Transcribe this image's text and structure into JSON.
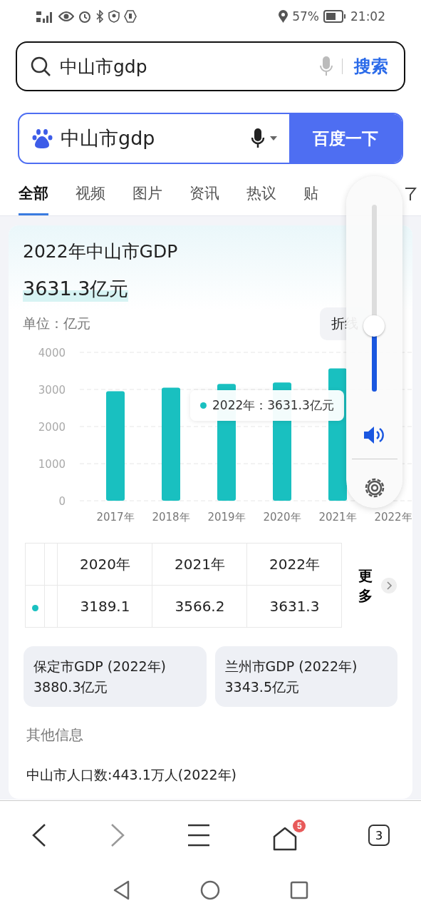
{
  "status_bar": {
    "battery": "57%",
    "time": "21:02"
  },
  "address_bar": {
    "value": "中山市gdp",
    "button": "搜索"
  },
  "search_box": {
    "value": "中山市gdp",
    "button": "百度一下"
  },
  "tabs": [
    {
      "label": "全部",
      "selected": true
    },
    {
      "label": "视频",
      "selected": false
    },
    {
      "label": "图片",
      "selected": false
    },
    {
      "label": "资讯",
      "selected": false
    },
    {
      "label": "热议",
      "selected": false
    },
    {
      "label": "贴",
      "selected": false
    }
  ],
  "result_card": {
    "title": "2022年中山市GDP",
    "value": "3631.3亿元",
    "unit": "单位：亿元",
    "chart_toggle": "折线",
    "chart_data": {
      "type": "bar",
      "categories": [
        "2017年",
        "2018年",
        "2019年",
        "2020年",
        "2021年",
        "2022年"
      ],
      "values": [
        2950,
        3050,
        3150,
        3189.1,
        3566.2,
        null
      ],
      "ylim": [
        0,
        4000
      ],
      "yticks": [
        0,
        1000,
        2000,
        3000,
        4000
      ],
      "grid": true
    },
    "tooltip": {
      "text": "2022年：3631.3亿元",
      "color": "#19c0c0"
    },
    "table": {
      "columns": [
        "2020年",
        "2021年",
        "2022年"
      ],
      "rows": [
        {
          "color": "#19c0c0",
          "values": [
            "3189.1",
            "3566.2",
            "3631.3"
          ]
        }
      ],
      "more": "更多"
    }
  },
  "related": [
    {
      "title": "保定市GDP (2022年)",
      "value": "3880.3亿元"
    },
    {
      "title": "兰州市GDP (2022年)",
      "value": "3343.5亿元"
    }
  ],
  "other_info": {
    "heading": "其他信息",
    "items": [
      "中山市人口数:443.1万人(2022年)"
    ]
  },
  "bottom_bar": {
    "forward_disabled": true,
    "home_badge": "5",
    "tab_count": "3"
  },
  "volume_panel": {
    "level": 0.35
  }
}
